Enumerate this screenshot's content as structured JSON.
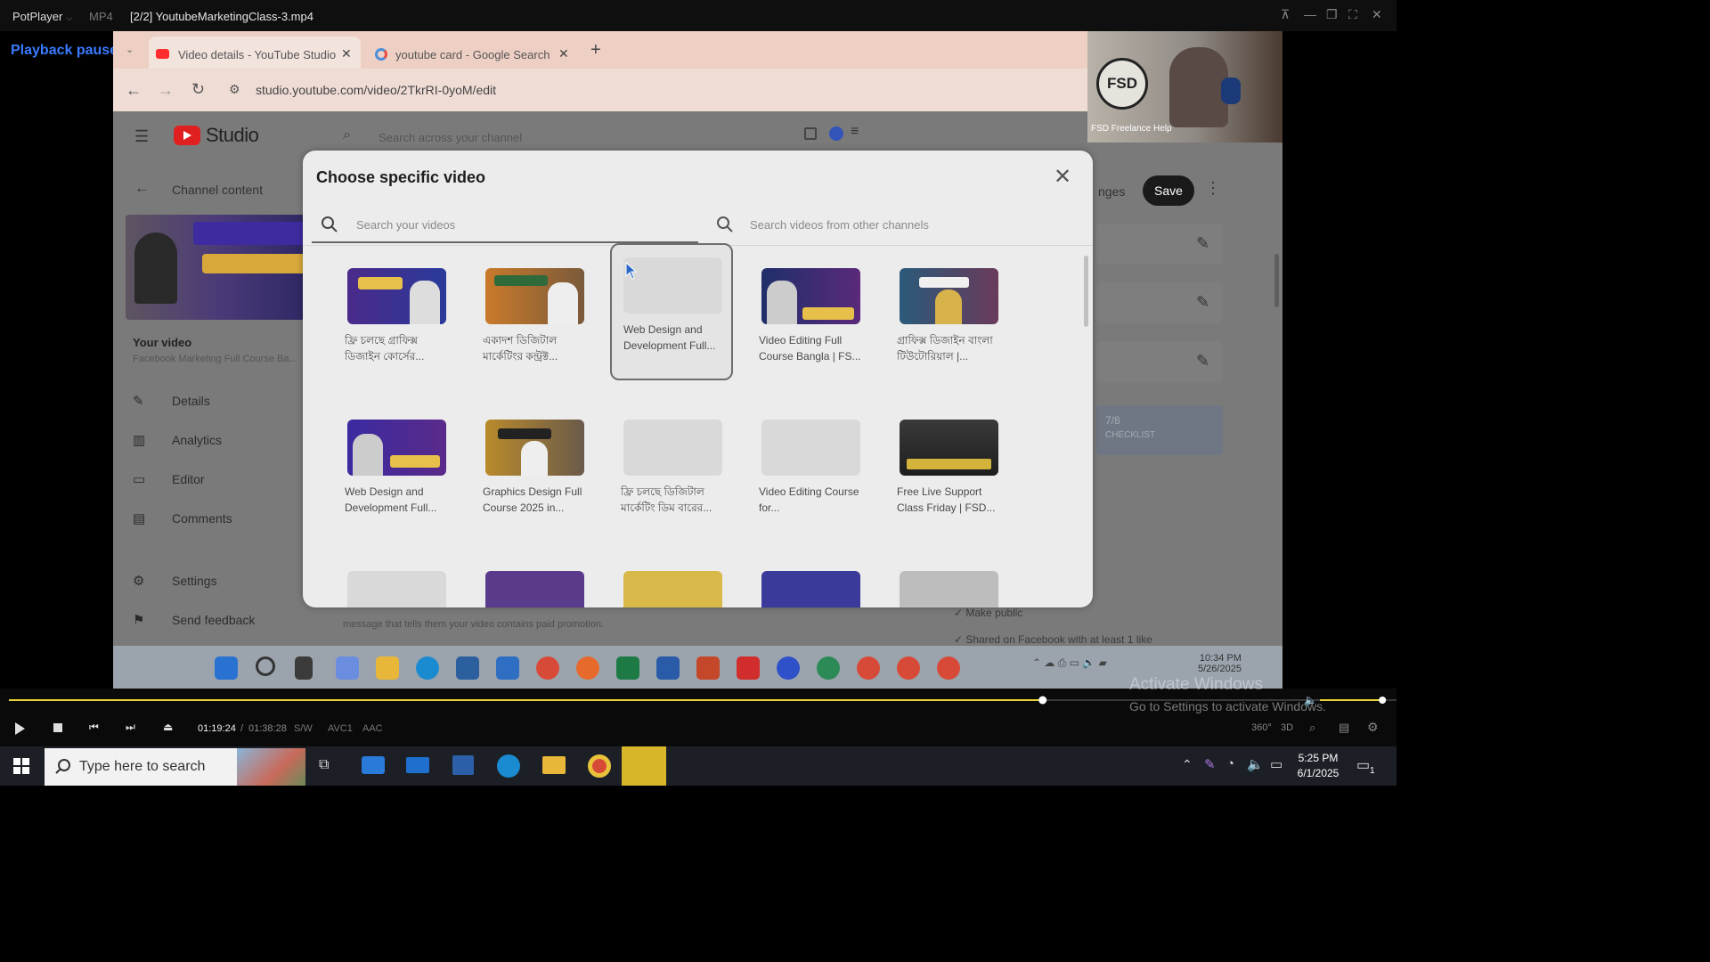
{
  "potplayer": {
    "app_name": "PotPlayer",
    "format": "MP4",
    "file_title": "[2/2] YoutubeMarketingClass-3.mp4",
    "status": "Playback paused",
    "time_current": "01:19:24",
    "time_separator": "/",
    "time_total": "01:38:28",
    "codec_sw": "S/W",
    "codec_video": "AVC1",
    "codec_audio": "AAC",
    "progress_fraction": 0.745,
    "volume_fraction": 0.9,
    "mode_360": "360°",
    "mode_3d": "3D"
  },
  "browser": {
    "tabs": [
      {
        "label": "Video details - YouTube Studio",
        "active": true
      },
      {
        "label": "youtube card - Google Search",
        "active": false
      }
    ],
    "url": "studio.youtube.com/video/2TkrRI-0yoM/edit"
  },
  "studio": {
    "logo_text": "Studio",
    "search_placeholder": "Search across your channel",
    "channel_content": "Channel content",
    "your_video_label": "Your video",
    "your_video_title": "Facebook Marketing Full Course Ba...",
    "nav": [
      {
        "label": "Details",
        "icon": "pencil-icon"
      },
      {
        "label": "Analytics",
        "icon": "analytics-icon"
      },
      {
        "label": "Editor",
        "icon": "editor-icon"
      },
      {
        "label": "Comments",
        "icon": "comments-icon"
      },
      {
        "label": "Settings",
        "icon": "gear-icon"
      },
      {
        "label": "Send feedback",
        "icon": "feedback-icon"
      }
    ],
    "undo_label": "nges",
    "save_label": "Save",
    "checklist_count": "7/8",
    "checklist_label": "CHECKLIST",
    "footer_text": "message that tells them your video contains paid promotion.",
    "make_public": "Make public",
    "shared_facebook": "Shared on Facebook with at least 1 like",
    "watermark_channel": "FSD Freelance Help"
  },
  "modal": {
    "title": "Choose specific video",
    "search_own_placeholder": "Search your videos",
    "search_other_placeholder": "Search videos from other channels",
    "videos": [
      {
        "title": "ফ্রি চলছে গ্রাফিক্স ডিজাইন কোর্সের...",
        "thumb": "purple",
        "selected": false
      },
      {
        "title": "একাদশ ডিজিটাল মার্কেটিংর কন্ট্রক্ট...",
        "thumb": "orange",
        "selected": false
      },
      {
        "title": "Web Design and Development Full...",
        "thumb": "blank",
        "selected": true
      },
      {
        "title": "Video Editing Full Course Bangla | FS...",
        "thumb": "navy",
        "selected": false
      },
      {
        "title": "গ্রাফিক্স ডিজাইন বাংলা টিউটোরিয়াল |...",
        "thumb": "teal",
        "selected": false
      },
      {
        "title": "Web Design and Development Full...",
        "thumb": "violet",
        "selected": false
      },
      {
        "title": "Graphics Design Full Course 2025 in...",
        "thumb": "amber",
        "selected": false
      },
      {
        "title": "ফ্রি চলছে ডিজিটাল মার্কেটিং ডিম বারের...",
        "thumb": "blank",
        "selected": false
      },
      {
        "title": "Video Editing Course for...",
        "thumb": "blank",
        "selected": false
      },
      {
        "title": "Free Live Support Class Friday | FSD...",
        "thumb": "dark",
        "selected": false
      }
    ]
  },
  "inner_taskbar": {
    "time": "10:34 PM",
    "date": "5/26/2025"
  },
  "windows": {
    "search_placeholder": "Type here to search",
    "time": "5:25 PM",
    "date": "6/1/2025",
    "notification_count": "1",
    "activate_line1": "Activate Windows",
    "activate_line2": "Go to Settings to activate Windows."
  },
  "colors": {
    "accent_blue": "#3a7bff",
    "seek_yellow": "#e8d33a",
    "youtube_red": "#ff0000"
  }
}
